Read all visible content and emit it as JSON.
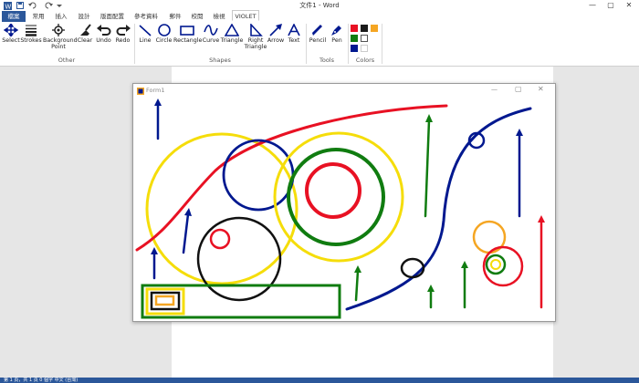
{
  "window": {
    "doc_title": "文件1 - Word",
    "minimize": "—",
    "restore": "▢",
    "close": "✕"
  },
  "quick_access": {
    "word_icon": "W",
    "save": "💾",
    "undo": "↶",
    "redo": "↻",
    "more": "▾"
  },
  "tabs": [
    "檔案",
    "常用",
    "插入",
    "設計",
    "版面配置",
    "參考資料",
    "郵件",
    "校閱",
    "檢視",
    "VIOLET"
  ],
  "active_tab": "VIOLET",
  "ribbon": {
    "other": {
      "label": "Other",
      "buttons": [
        "Select",
        "Strokes",
        "Background Point",
        "Clear",
        "Undo",
        "Redo"
      ]
    },
    "shapes": {
      "label": "Shapes",
      "buttons": [
        "Line",
        "Circle",
        "Rectangle",
        "Curve",
        "Triangle",
        "Right Triangle",
        "Arrow",
        "Text"
      ]
    },
    "tools": {
      "label": "Tools",
      "buttons": [
        "Pencil",
        "Pen"
      ]
    },
    "colors": {
      "label": "Colors",
      "swatches": [
        "#e81123",
        "#1a1a1a",
        "#f5a623",
        "#107c10",
        "#ffffff",
        "#00188f",
        "#ffffff"
      ]
    }
  },
  "form": {
    "title": "Form1",
    "minimize": "—",
    "maximize": "▢",
    "close": "✕"
  },
  "status": {
    "text": "第 1 頁，共 1 頁    0 個字    中文 (台灣)"
  }
}
